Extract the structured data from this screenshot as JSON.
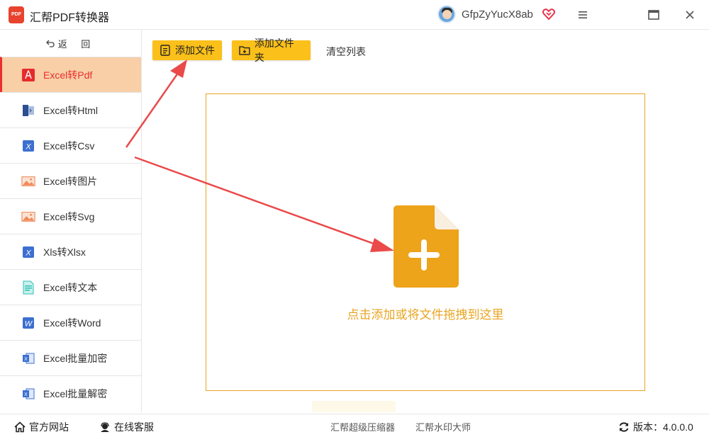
{
  "app": {
    "title": "汇帮PDF转换器",
    "logo_text": "PDF"
  },
  "user": {
    "name": "GfpZyYucX8ab"
  },
  "sidebar": {
    "back_label": "返 回",
    "items": [
      {
        "label": "Excel转Pdf",
        "icon": "pdf-icon",
        "active": true
      },
      {
        "label": "Excel转Html",
        "icon": "html-icon"
      },
      {
        "label": "Excel转Csv",
        "icon": "excel-x-icon"
      },
      {
        "label": "Excel转图片",
        "icon": "image-icon"
      },
      {
        "label": "Excel转Svg",
        "icon": "image-icon"
      },
      {
        "label": "Xls转Xlsx",
        "icon": "excel-x-icon"
      },
      {
        "label": "Excel转文本",
        "icon": "text-file-icon"
      },
      {
        "label": "Excel转Word",
        "icon": "word-icon"
      },
      {
        "label": "Excel批量加密",
        "icon": "excel-icon"
      },
      {
        "label": "Excel批量解密",
        "icon": "excel-icon"
      }
    ]
  },
  "toolbar": {
    "add_file": "添加文件",
    "add_folder": "添加文件夹",
    "clear_list": "清空列表"
  },
  "dropzone": {
    "hint": "点击添加或将文件拖拽到这里"
  },
  "footer": {
    "website": "官方网站",
    "service": "在线客服",
    "compressor": "汇帮超级压缩器",
    "watermark": "汇帮水印大师",
    "version": "版本：4.0.0.0"
  },
  "colors": {
    "accent": "#fbc01a",
    "active_bg": "#f8cfa7",
    "active_text": "#ea2f2f",
    "drop_border": "#e9a523",
    "arrow": "#ea4a4a"
  }
}
